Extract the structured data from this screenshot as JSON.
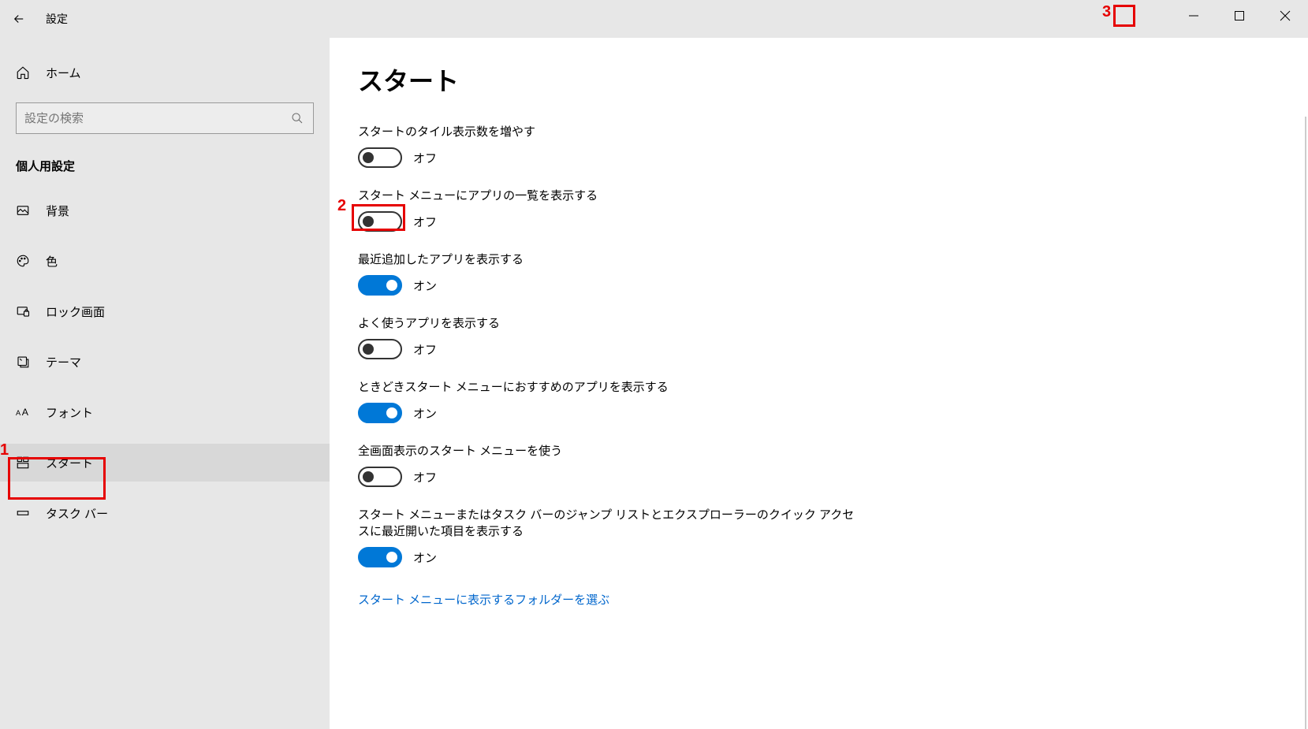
{
  "window": {
    "title": "設定"
  },
  "sidebar": {
    "home": "ホーム",
    "search_placeholder": "設定の検索",
    "section": "個人用設定",
    "items": [
      {
        "label": "背景"
      },
      {
        "label": "色"
      },
      {
        "label": "ロック画面"
      },
      {
        "label": "テーマ"
      },
      {
        "label": "フォント"
      },
      {
        "label": "スタート"
      },
      {
        "label": "タスク バー"
      }
    ]
  },
  "page": {
    "heading": "スタート",
    "state_on": "オン",
    "state_off": "オフ",
    "settings": [
      {
        "label": "スタートのタイル表示数を増やす",
        "on": false
      },
      {
        "label": "スタート メニューにアプリの一覧を表示する",
        "on": false
      },
      {
        "label": "最近追加したアプリを表示する",
        "on": true
      },
      {
        "label": "よく使うアプリを表示する",
        "on": false
      },
      {
        "label": "ときどきスタート メニューにおすすめのアプリを表示する",
        "on": true
      },
      {
        "label": "全画面表示のスタート メニューを使う",
        "on": false
      },
      {
        "label": "スタート メニューまたはタスク バーのジャンプ リストとエクスプローラーのクイック アクセスに最近開いた項目を表示する",
        "on": true
      }
    ],
    "link": "スタート メニューに表示するフォルダーを選ぶ"
  },
  "annotations": {
    "n1": "1",
    "n2": "2",
    "n3": "3"
  }
}
